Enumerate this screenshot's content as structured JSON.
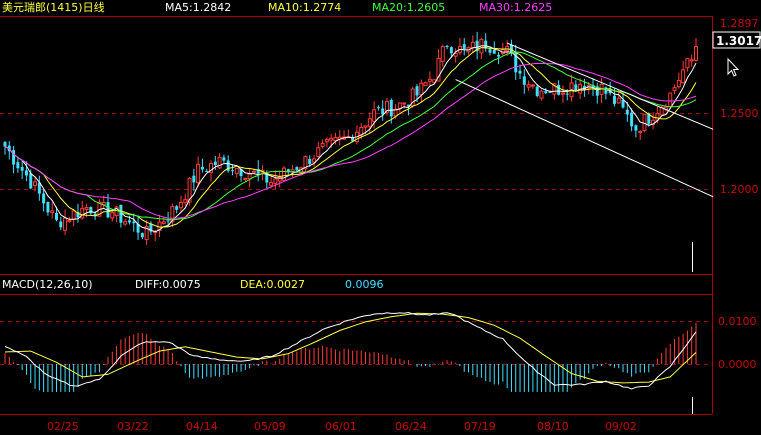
{
  "header": {
    "title": "美元瑞郎(1415)日线",
    "ma5": "MA5:1.2842",
    "ma10": "MA10:1.2774",
    "ma20": "MA20:1.2605",
    "ma30": "MA30:1.2625"
  },
  "macd_header": {
    "name": "MACD(12,26,10)",
    "diff": "DIFF:0.0075",
    "dea": "DEA:0.0027",
    "macd": "0.0096"
  },
  "price_axis": {
    "high_label": "1.2897",
    "current_label": "1.3017",
    "ticks": [
      "1.2500",
      "1.2000"
    ]
  },
  "macd_axis": {
    "ticks": [
      "0.0100",
      "0.0000"
    ]
  },
  "x_axis_labels": [
    "02/25",
    "03/22",
    "04/14",
    "05/09",
    "06/01",
    "06/24",
    "07/19",
    "08/10",
    "09/02"
  ],
  "colors": {
    "background": "#000000",
    "up": "#ff3b3b",
    "down": "#3fe0ff",
    "ma5": "#ffffff",
    "ma10": "#ffff40",
    "ma20": "#40ff40",
    "ma30": "#ff40ff",
    "grid": "#9b1010",
    "axis_text": "#c80000",
    "title": "#ffff40",
    "label_white": "#ffffff"
  },
  "chart_data": [
    {
      "type": "candlestick",
      "title": "美元瑞郎(1415)日线",
      "ylim": [
        1.165,
        1.315
      ],
      "y_ticks": [
        1.25,
        1.2
      ],
      "highest_marked": 1.2897,
      "current_price": 1.3017,
      "x_ticks": [
        "02/25",
        "03/22",
        "04/14",
        "05/09",
        "06/01",
        "06/24",
        "07/19",
        "08/10",
        "09/02"
      ],
      "ma_series": [
        {
          "name": "MA5",
          "last": 1.2842
        },
        {
          "name": "MA10",
          "last": 1.2774
        },
        {
          "name": "MA20",
          "last": 1.2605
        },
        {
          "name": "MA30",
          "last": 1.2625
        }
      ],
      "anchors": [
        [
          0,
          1.228
        ],
        [
          6,
          1.205
        ],
        [
          12,
          1.178
        ],
        [
          19,
          1.188
        ],
        [
          25,
          1.185
        ],
        [
          33,
          1.17
        ],
        [
          40,
          1.188
        ],
        [
          45,
          1.212
        ],
        [
          50,
          1.218
        ],
        [
          56,
          1.212
        ],
        [
          62,
          1.205
        ],
        [
          68,
          1.215
        ],
        [
          74,
          1.226
        ],
        [
          80,
          1.234
        ],
        [
          86,
          1.25
        ],
        [
          91,
          1.254
        ],
        [
          96,
          1.262
        ],
        [
          100,
          1.276
        ],
        [
          103,
          1.296
        ],
        [
          107,
          1.29
        ],
        [
          112,
          1.296
        ],
        [
          117,
          1.29
        ],
        [
          120,
          1.276
        ],
        [
          124,
          1.266
        ],
        [
          129,
          1.266
        ],
        [
          134,
          1.27
        ],
        [
          139,
          1.266
        ],
        [
          143,
          1.255
        ],
        [
          147,
          1.24
        ],
        [
          151,
          1.25
        ],
        [
          155,
          1.262
        ],
        [
          158,
          1.278
        ],
        [
          161,
          1.288
        ]
      ],
      "channel": {
        "upper": [
          [
            117,
            1.296
          ],
          [
            161,
            1.244
          ]
        ],
        "lower": [
          [
            105,
            1.272
          ],
          [
            161,
            1.2
          ]
        ]
      }
    },
    {
      "type": "macd",
      "title": "MACD(12,26,10)",
      "ylim": [
        -0.0065,
        0.0135
      ],
      "y_ticks": [
        0.01,
        0.0
      ],
      "diff": 0.0075,
      "dea": 0.0027,
      "macd": 0.0096,
      "diff_anchors": [
        [
          0,
          0.0042
        ],
        [
          5,
          0.0016
        ],
        [
          10,
          -0.0028
        ],
        [
          16,
          -0.0052
        ],
        [
          22,
          -0.0036
        ],
        [
          27,
          0.0018
        ],
        [
          32,
          0.005
        ],
        [
          38,
          0.0052
        ],
        [
          44,
          0.0018
        ],
        [
          50,
          0.001
        ],
        [
          56,
          0.0006
        ],
        [
          62,
          0.0018
        ],
        [
          68,
          0.0048
        ],
        [
          74,
          0.008
        ],
        [
          80,
          0.0102
        ],
        [
          86,
          0.0117
        ],
        [
          92,
          0.012
        ],
        [
          98,
          0.0114
        ],
        [
          104,
          0.0118
        ],
        [
          110,
          0.0086
        ],
        [
          116,
          0.0058
        ],
        [
          122,
          -0.0002
        ],
        [
          128,
          -0.0048
        ],
        [
          134,
          -0.0048
        ],
        [
          140,
          -0.004
        ],
        [
          146,
          -0.0058
        ],
        [
          150,
          -0.005
        ],
        [
          155,
          -0.0006
        ],
        [
          161,
          0.0075
        ]
      ],
      "dea_anchors": [
        [
          0,
          0.0028
        ],
        [
          6,
          0.003
        ],
        [
          12,
          0.0004
        ],
        [
          18,
          -0.003
        ],
        [
          24,
          -0.0024
        ],
        [
          30,
          0.0004
        ],
        [
          36,
          0.003
        ],
        [
          42,
          0.004
        ],
        [
          48,
          0.0028
        ],
        [
          54,
          0.0016
        ],
        [
          60,
          0.0012
        ],
        [
          66,
          0.0024
        ],
        [
          72,
          0.005
        ],
        [
          78,
          0.0078
        ],
        [
          84,
          0.0098
        ],
        [
          90,
          0.011
        ],
        [
          96,
          0.0118
        ],
        [
          102,
          0.0116
        ],
        [
          108,
          0.0108
        ],
        [
          114,
          0.009
        ],
        [
          120,
          0.006
        ],
        [
          126,
          0.0018
        ],
        [
          132,
          -0.0022
        ],
        [
          138,
          -0.004
        ],
        [
          144,
          -0.0044
        ],
        [
          150,
          -0.0042
        ],
        [
          155,
          -0.003
        ],
        [
          161,
          0.0027
        ]
      ]
    }
  ]
}
